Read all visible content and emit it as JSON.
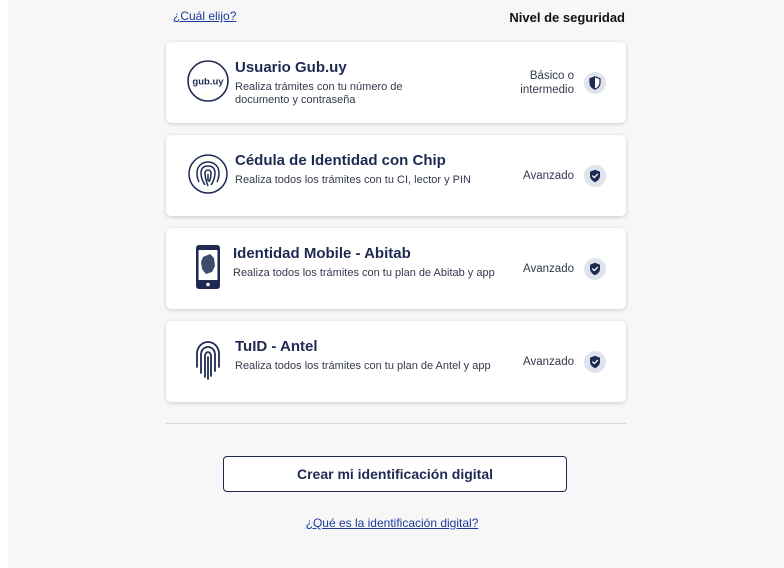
{
  "header": {
    "which_link": "¿Cuál elijo?",
    "level_title": "Nivel de seguridad"
  },
  "options": [
    {
      "title": "Usuario Gub.uy",
      "description": "Realiza trámites con tu número de documento y contraseña",
      "level_line1": "Básico o",
      "level_line2": "intermedio",
      "icon": "gub-uy-logo-icon",
      "icon_text": "gub.uy",
      "shield": "half"
    },
    {
      "title": "Cédula de Identidad con Chip",
      "description": "Realiza todos los trámites con tu CI, lector y PIN",
      "level_line1": "Avanzado",
      "level_line2": "",
      "icon": "fingerprint-badge-icon",
      "shield": "full"
    },
    {
      "title": "Identidad Mobile - Abitab",
      "description": "Realiza todos los trámites con tu plan de Abitab y app",
      "level_line1": "Avanzado",
      "level_line2": "",
      "icon": "mobile-phone-icon",
      "shield": "full"
    },
    {
      "title": "TuID - Antel",
      "description": "Realiza todos los trámites con tu plan de Antel y app",
      "level_line1": "Avanzado",
      "level_line2": "",
      "icon": "fingerprint-icon",
      "shield": "full"
    }
  ],
  "footer": {
    "create_button": "Crear mi identificación digital",
    "what_link": "¿Qué es la identificación digital?"
  },
  "colors": {
    "primary": "#1e2a52",
    "link": "#1a3a9c",
    "background": "#f7f7f8",
    "shield_bg": "#dfe3ee"
  }
}
